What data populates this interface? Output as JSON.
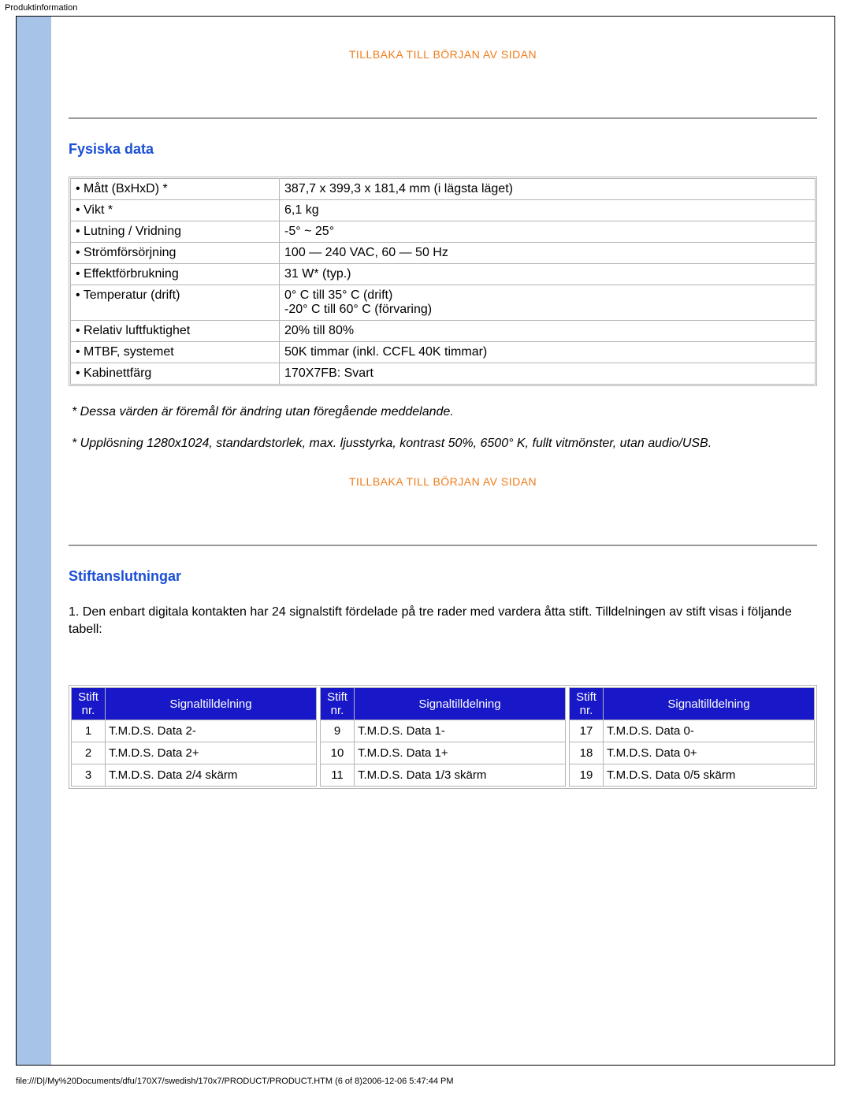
{
  "page_title": "Produktinformation",
  "toplink_label": "TILLBAKA TILL BÖRJAN AV SIDAN",
  "section_physical": "Fysiska data",
  "physical_rows": [
    {
      "label": "• Mått (BxHxD) *",
      "value": "387,7 x 399,3 x 181,4 mm (i lägsta läget)"
    },
    {
      "label": "• Vikt *",
      "value": "6,1 kg"
    },
    {
      "label": "• Lutning / Vridning",
      "value": "-5° ~ 25°"
    },
    {
      "label": "• Strömförsörjning",
      "value": "100 — 240 VAC, 60 — 50 Hz"
    },
    {
      "label": "• Effektförbrukning",
      "value": "31 W* (typ.)"
    },
    {
      "label": "• Temperatur (drift)",
      "value": "0° C till 35° C (drift)\n-20° C till 60° C (förvaring)"
    },
    {
      "label": "• Relativ luftfuktighet",
      "value": "20% till 80%"
    },
    {
      "label": "• MTBF, systemet",
      "value": "50K timmar (inkl. CCFL 40K timmar)"
    },
    {
      "label": "• Kabinettfärg",
      "value": "170X7FB: Svart"
    }
  ],
  "note1": "* Dessa värden är föremål för ändring utan föregående meddelande.",
  "note2": "* Upplösning 1280x1024, standardstorlek, max. ljusstyrka, kontrast 50%, 6500° K, fullt vitmönster, utan audio/USB.",
  "section_pins": "Stiftanslutningar",
  "pin_intro": "1. Den enbart digitala kontakten har 24 signalstift fördelade på tre rader med vardera åtta stift. Tilldelningen av stift visas i följande tabell:",
  "pin_headers": {
    "num": "Stift nr.",
    "sig": "Signaltilldelning"
  },
  "pin_cols": [
    [
      {
        "n": "1",
        "s": "T.M.D.S. Data 2-"
      },
      {
        "n": "2",
        "s": "T.M.D.S. Data 2+"
      },
      {
        "n": "3",
        "s": "T.M.D.S. Data 2/4 skärm"
      }
    ],
    [
      {
        "n": "9",
        "s": "T.M.D.S. Data 1-"
      },
      {
        "n": "10",
        "s": "T.M.D.S. Data 1+"
      },
      {
        "n": "11",
        "s": "T.M.D.S. Data 1/3 skärm"
      }
    ],
    [
      {
        "n": "17",
        "s": "T.M.D.S. Data 0-"
      },
      {
        "n": "18",
        "s": "T.M.D.S. Data 0+"
      },
      {
        "n": "19",
        "s": "T.M.D.S. Data 0/5 skärm"
      }
    ]
  ],
  "footer": "file:///D|/My%20Documents/dfu/170X7/swedish/170x7/PRODUCT/PRODUCT.HTM (6 of 8)2006-12-06 5:47:44 PM"
}
